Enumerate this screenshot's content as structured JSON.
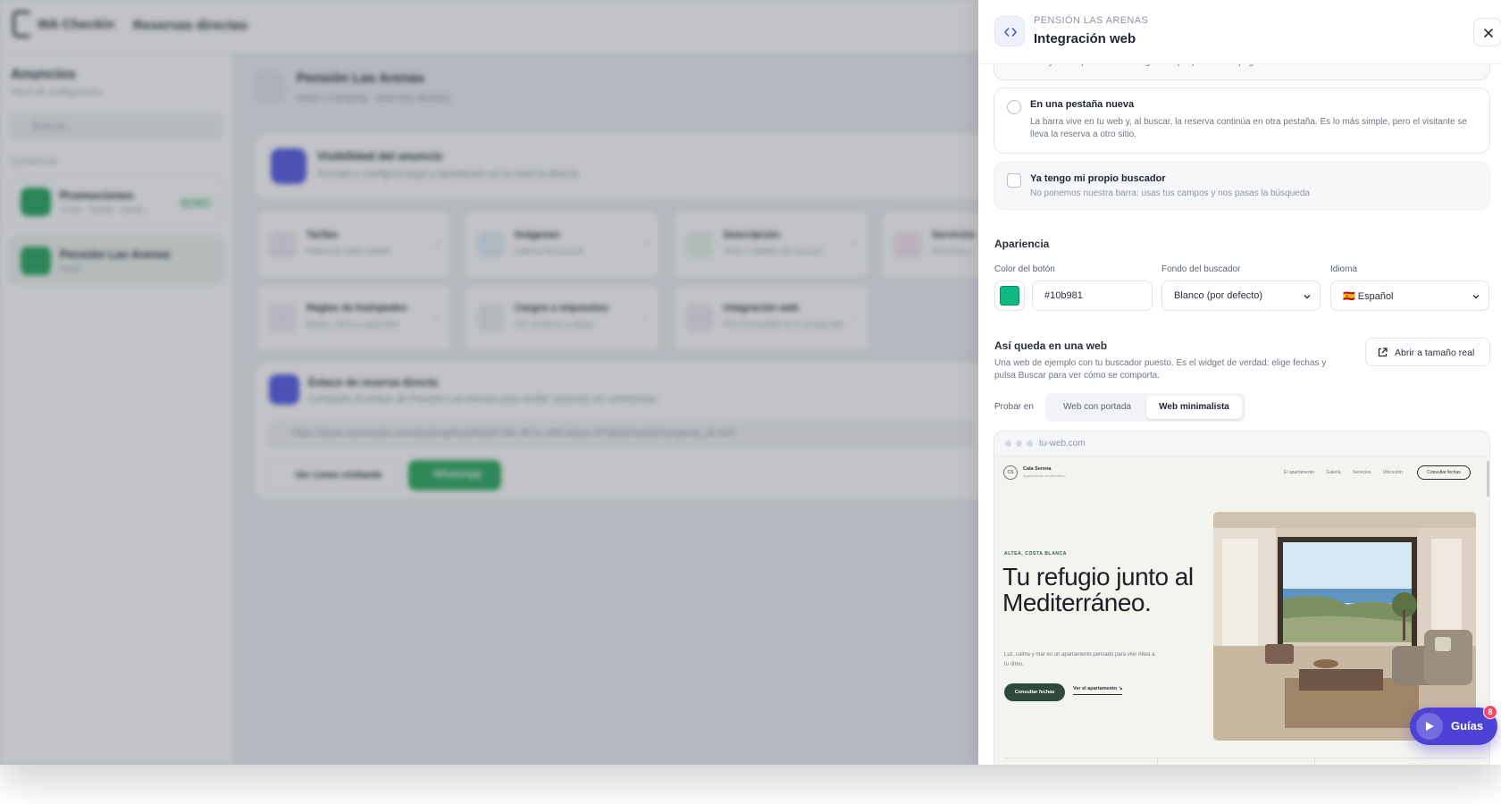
{
  "app": {
    "logo_text": "WA Checkin",
    "logo_brand": "Checkin",
    "page_title": "Reservas directas"
  },
  "sidebar": {
    "title": "Anuncios",
    "subtitle": "Panel de configuración",
    "search_placeholder": "Buscar...",
    "section_label": "GENERAL",
    "items": [
      {
        "title": "Promociones",
        "subtitle": "Crear · Editar · Gesti...",
        "badge": "By WAC"
      },
      {
        "title": "Pensión Las Arenas",
        "subtitle": "Hotel"
      }
    ]
  },
  "main": {
    "title": "Pensión Las Arenas",
    "subtitle": "Hotel / Camping · reservas directas",
    "visibility": {
      "title": "Visibilidad del anuncio",
      "subtitle": "Actívalo y configura pago y aprobación en la reserva directa"
    },
    "tiles": [
      {
        "title": "Tarifas",
        "subtitle": "Planes de tarifa visibles"
      },
      {
        "title": "Imágenes",
        "subtitle": "Galería del anuncio"
      },
      {
        "title": "Descripción",
        "subtitle": "Texto y detalles del anuncio"
      },
      {
        "title": "Servicios",
        "subtitle": "Servicios y..."
      },
      {
        "title": "Reglas de huéspedes",
        "subtitle": "Bebés, niños y capacidad"
      },
      {
        "title": "Cargos e impuestos",
        "subtitle": "IVA, limpieza y cargos"
      },
      {
        "title": "Integración web",
        "subtitle": "Pon el buscador en tu propia web"
      }
    ],
    "link_card": {
      "title": "Enlace de reserva directa",
      "subtitle": "Comparte el enlace de Pensión Las Arenas para recibir reservas sin comisiones",
      "url": "https://book.wacheckin.com/booking/hotel/9daf706c-807e-4f05-b8a4-d75db8e5a0eb?property_id=420",
      "visitor_button": "Ver como visitante",
      "whatsapp_button": "WhatsApp"
    }
  },
  "panel": {
    "kicker": "PENSIÓN LAS ARENAS",
    "title": "Integración web",
    "top_option_text": "no hay nada que cerrar. Tú eliges en qué punto de la página sale.",
    "options": [
      {
        "title": "En una pestaña nueva",
        "description": "La barra vive en tu web y, al buscar, la reserva continúa en otra pestaña. Es lo más simple, pero el visitante se lleva la reserva a otro sitio."
      },
      {
        "title": "Ya tengo mi propio buscador",
        "description": "No ponemos nuestra barra: usas tus campos y nos pasas la búsqueda"
      }
    ],
    "appearance": {
      "section_title": "Apariencia",
      "button_color_label": "Color del botón",
      "button_color_value": "#10b981",
      "background_label": "Fondo del buscador",
      "background_value": "Blanco (por defecto)",
      "language_label": "Idioma",
      "language_value": "🇪🇸 Español"
    },
    "preview": {
      "title": "Así queda en una web",
      "subtitle": "Una web de ejemplo con tu buscador puesto. Es el widget de verdad: elige fechas y pulsa Buscar para ver cómo se comporta.",
      "real_size_button": "Abrir a tamaño real",
      "try_label": "Probar en",
      "tabs": [
        "Web con portada",
        "Web minimalista"
      ],
      "selected_tab": "Web minimalista",
      "browser_url": "tu-web.com"
    },
    "demo_site": {
      "logo_initials": "CS",
      "name": "Cala Serena",
      "tagline": "Apartamento mediterráneo",
      "nav": [
        "El apartamento",
        "Galería",
        "Servicios",
        "Ubicación"
      ],
      "nav_cta": "Consultar fechas",
      "kicker": "ALTEA, COSTA BLANCA",
      "headline": "Tu refugio junto al Mediterráneo.",
      "body": "Luz, calma y mar en un apartamento pensado para vivir Altea a tu ritmo.",
      "cta": "Consultar fechas",
      "secondary_link": "Ver el apartamento ↘"
    }
  },
  "guides": {
    "label": "Guías",
    "badge": "8"
  },
  "colors": {
    "accent": "#4e42d6",
    "brand_green": "#1fa35a",
    "swatch": "#10b981"
  }
}
